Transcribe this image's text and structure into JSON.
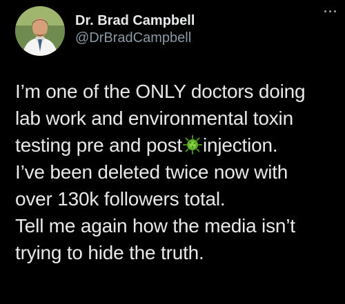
{
  "author": {
    "display_name": "Dr. Brad Campbell",
    "handle": "@DrBradCampbell"
  },
  "tweet": {
    "lines": [
      {
        "before": "I’m one of the ONLY doctors doing"
      },
      {
        "before": "lab work and environmental toxin"
      },
      {
        "before": "testing pre and post",
        "emoji": "microbe-emoji",
        "after": "injection."
      },
      {
        "before": "I’ve been deleted twice now with"
      },
      {
        "before": "over 130k followers total."
      },
      {
        "before": "Tell me again how the media isn’t"
      },
      {
        "before": "trying to hide the truth."
      }
    ]
  },
  "icons": {
    "more": "more-options-icon",
    "avatar": "profile-photo",
    "emoji": "microbe-emoji"
  },
  "colors": {
    "background": "#000000",
    "text": "#e7e9ea",
    "secondary_text": "#8b98a5",
    "emoji_green": "#5fae2a"
  }
}
